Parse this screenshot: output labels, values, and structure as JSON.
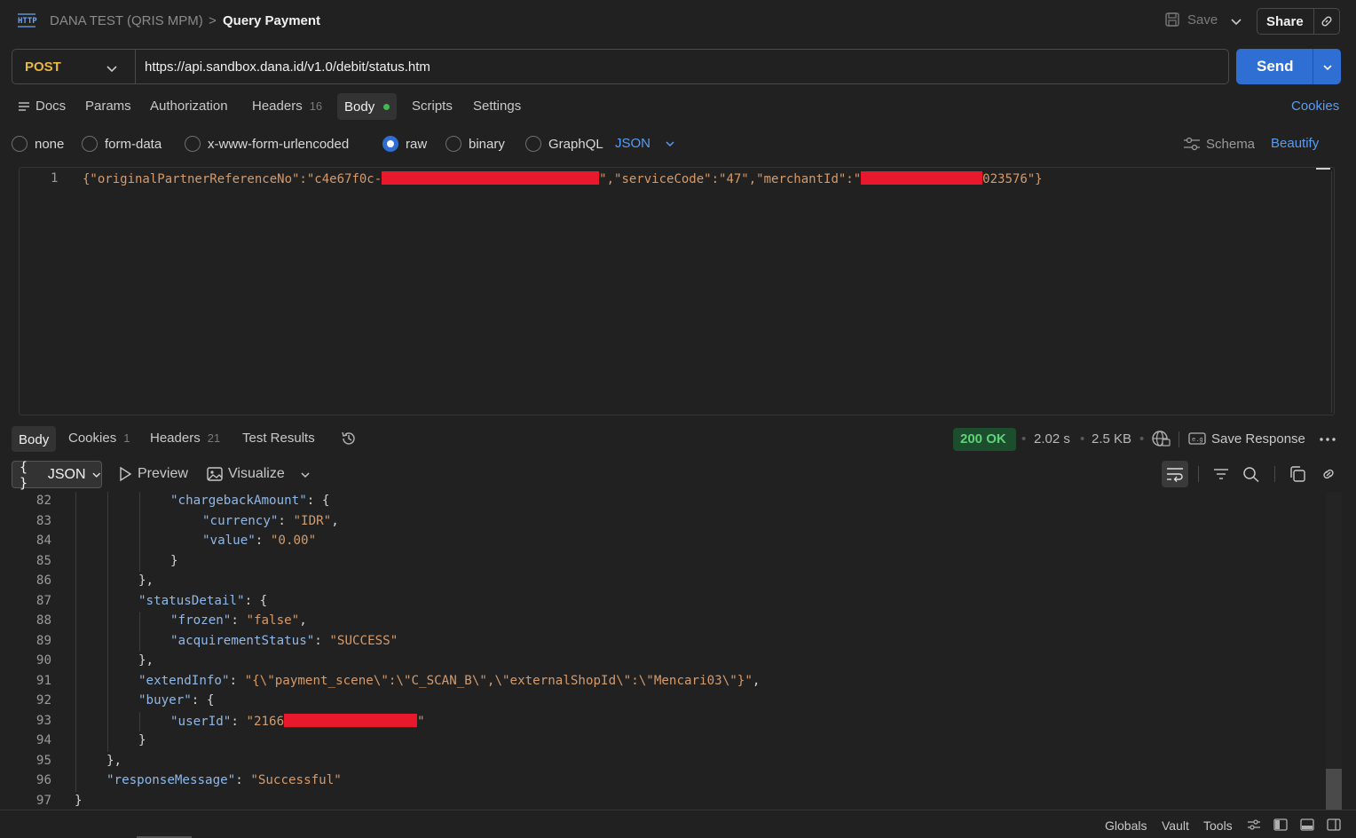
{
  "header": {
    "icon_label": "HTTP",
    "breadcrumb_parent": "DANA TEST (QRIS MPM)",
    "breadcrumb_sep": ">",
    "breadcrumb_current": "Query Payment",
    "save_label": "Save",
    "share_label": "Share"
  },
  "request": {
    "method": "POST",
    "url": "https://api.sandbox.dana.id/v1.0/debit/status.htm",
    "send_label": "Send",
    "tabs": [
      {
        "label": "Docs"
      },
      {
        "label": "Params"
      },
      {
        "label": "Authorization"
      },
      {
        "label": "Headers",
        "count": "16"
      },
      {
        "label": "Body"
      },
      {
        "label": "Scripts"
      },
      {
        "label": "Settings"
      }
    ],
    "cookies_label": "Cookies",
    "body_types": [
      "none",
      "form-data",
      "x-www-form-urlencoded",
      "raw",
      "binary",
      "GraphQL"
    ],
    "selected_body_type": "raw",
    "format_label": "JSON",
    "schema_label": "Schema",
    "beautify_label": "Beautify",
    "body_line_no": "1",
    "body_parts": {
      "open": "{\"originalPartnerReferenceNo\":\"",
      "ref_visible": "c4e67f0c-",
      "mid": "\",\"serviceCode\":\"47\",\"merchantId\":\"",
      "merchant_visible": "023576",
      "close": "\"}"
    }
  },
  "response": {
    "tabs": [
      {
        "label": "Body"
      },
      {
        "label": "Cookies",
        "count": "1"
      },
      {
        "label": "Headers",
        "count": "21"
      },
      {
        "label": "Test Results"
      }
    ],
    "status": "200 OK",
    "time": "2.02 s",
    "size": "2.5 KB",
    "save_response_label": "Save Response",
    "format_label": "JSON",
    "format_icon": "{ }",
    "preview_label": "Preview",
    "visualize_label": "Visualize",
    "lines": [
      {
        "n": "82",
        "indent": 3,
        "parts": [
          [
            "key",
            "\"chargebackAmount\""
          ],
          [
            "punc",
            ": {"
          ]
        ]
      },
      {
        "n": "83",
        "indent": 4,
        "parts": [
          [
            "key",
            "\"currency\""
          ],
          [
            "punc",
            ": "
          ],
          [
            "str",
            "\"IDR\""
          ],
          [
            "punc",
            ","
          ]
        ]
      },
      {
        "n": "84",
        "indent": 4,
        "parts": [
          [
            "key",
            "\"value\""
          ],
          [
            "punc",
            ": "
          ],
          [
            "str",
            "\"0.00\""
          ]
        ]
      },
      {
        "n": "85",
        "indent": 3,
        "parts": [
          [
            "punc",
            "}"
          ]
        ]
      },
      {
        "n": "86",
        "indent": 2,
        "parts": [
          [
            "punc",
            "},"
          ]
        ]
      },
      {
        "n": "87",
        "indent": 2,
        "parts": [
          [
            "key",
            "\"statusDetail\""
          ],
          [
            "punc",
            ": {"
          ]
        ]
      },
      {
        "n": "88",
        "indent": 3,
        "parts": [
          [
            "key",
            "\"frozen\""
          ],
          [
            "punc",
            ": "
          ],
          [
            "str",
            "\"false\""
          ],
          [
            "punc",
            ","
          ]
        ]
      },
      {
        "n": "89",
        "indent": 3,
        "parts": [
          [
            "key",
            "\"acquirementStatus\""
          ],
          [
            "punc",
            ": "
          ],
          [
            "str",
            "\"SUCCESS\""
          ]
        ]
      },
      {
        "n": "90",
        "indent": 2,
        "parts": [
          [
            "punc",
            "},"
          ]
        ]
      },
      {
        "n": "91",
        "indent": 2,
        "parts": [
          [
            "key",
            "\"extendInfo\""
          ],
          [
            "punc",
            ": "
          ],
          [
            "str",
            "\"{\\\"payment_scene\\\":\\\"C_SCAN_B\\\",\\\"externalShopId\\\":\\\"Mencari03\\\"}\""
          ],
          [
            "punc",
            ","
          ]
        ]
      },
      {
        "n": "92",
        "indent": 2,
        "parts": [
          [
            "key",
            "\"buyer\""
          ],
          [
            "punc",
            ": {"
          ]
        ]
      },
      {
        "n": "93",
        "indent": 3,
        "parts": [
          [
            "key",
            "\"userId\""
          ],
          [
            "punc",
            ": "
          ],
          [
            "str",
            "\"2166"
          ],
          [
            "redact",
            ""
          ],
          [
            "str",
            "\""
          ]
        ]
      },
      {
        "n": "94",
        "indent": 2,
        "parts": [
          [
            "punc",
            "}"
          ]
        ]
      },
      {
        "n": "95",
        "indent": 1,
        "parts": [
          [
            "punc",
            "},"
          ]
        ]
      },
      {
        "n": "96",
        "indent": 1,
        "parts": [
          [
            "key",
            "\"responseMessage\""
          ],
          [
            "punc",
            ": "
          ],
          [
            "str",
            "\"Successful\""
          ]
        ]
      },
      {
        "n": "97",
        "indent": 0,
        "parts": [
          [
            "punc",
            "}"
          ]
        ]
      }
    ]
  },
  "footer": {
    "globals_label": "Globals",
    "vault_label": "Vault",
    "tools_label": "Tools"
  },
  "colors": {
    "accent_blue": "#2f6ed3",
    "method_yellow": "#e8b845",
    "status_green": "#5fd27a",
    "json_key": "#8fb8e8",
    "json_string": "#d49b6c",
    "redaction": "#e8192c"
  },
  "icons": [
    "http-icon",
    "save-icon",
    "chevron-down-icon",
    "link-icon",
    "docs-icon",
    "schema-icon",
    "history-icon",
    "globe-icon",
    "save-response-icon",
    "more-icon",
    "play-icon",
    "image-icon",
    "wrap-icon",
    "filter-icon",
    "search-icon",
    "copy-icon",
    "settings-icon",
    "layout-icon"
  ]
}
